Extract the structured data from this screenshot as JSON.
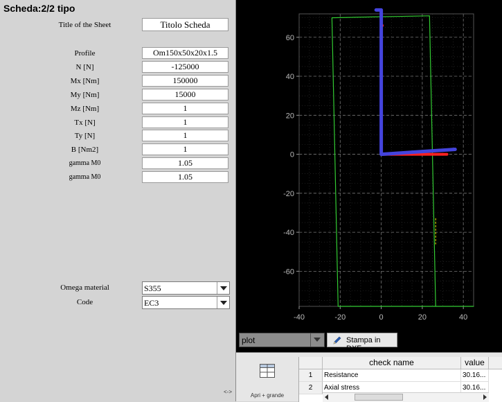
{
  "sheet_title": "Scheda:2/2 tipo",
  "form": {
    "title_of_sheet": {
      "label": "Title of the Sheet",
      "value": "Titolo Scheda"
    },
    "fields": [
      {
        "label": "Profile",
        "value": "Om150x50x20x1.5"
      },
      {
        "label": "N [N]",
        "value": "-125000"
      },
      {
        "label": "Mx [Nm]",
        "value": "150000"
      },
      {
        "label": "My [Nm]",
        "value": "15000"
      },
      {
        "label": "Mz [Nm]",
        "value": "1"
      },
      {
        "label": "Tx [N]",
        "value": "1"
      },
      {
        "label": "Ty [N]",
        "value": "1"
      },
      {
        "label": "B [Nm2]",
        "value": "1"
      },
      {
        "label": "gamma M0",
        "value": "1.05"
      },
      {
        "label": "gamma M0",
        "value": "1.05"
      }
    ],
    "omega_material": {
      "label": "Omega material",
      "value": "S355"
    },
    "code": {
      "label": "Code",
      "value": "EC3"
    },
    "resize_mark": "<->"
  },
  "plot": {
    "x_ticks": [
      "-40",
      "-20",
      "0",
      "20",
      "40"
    ],
    "y_ticks": [
      "60",
      "40",
      "20",
      "0",
      "-20",
      "-40",
      "-60"
    ],
    "colors": {
      "outline": "#33cc33",
      "red_axis": "#ff2222",
      "blue_axis": "#4444dd",
      "marker": "#cccc00",
      "grid": "#777777",
      "background": "#000000"
    },
    "select_value": "plot",
    "dxf_button": "Stampa in DXF"
  },
  "chart_data": {
    "type": "line",
    "title": "",
    "xlabel": "",
    "ylabel": "",
    "xlim": [
      -40,
      45
    ],
    "ylim": [
      -78,
      72
    ],
    "grid": true,
    "series": [
      {
        "kind": "outline",
        "color": "#33cc33",
        "x": [
          -24,
          23.5,
          26.5,
          45,
          45,
          -21,
          -24
        ],
        "y": [
          70,
          71,
          -78,
          -78,
          -78,
          -78,
          70
        ]
      },
      {
        "kind": "red",
        "color": "#ff2222",
        "x": [
          0.5,
          0,
          0,
          32
        ],
        "y": [
          66,
          66,
          0,
          0
        ]
      },
      {
        "kind": "blue",
        "color": "#4444dd",
        "x": [
          -2.5,
          0,
          0,
          36
        ],
        "y": [
          74,
          74,
          0,
          2.5
        ]
      },
      {
        "kind": "marker",
        "color": "#cccc00",
        "x": [
          26.5,
          26.5
        ],
        "y": [
          -33,
          -46
        ]
      }
    ]
  },
  "results_panel": {
    "open_large_label": "Apri + grande",
    "columns": [
      "check name",
      "value"
    ],
    "rows": [
      {
        "n": "1",
        "name": "Resistance",
        "value": "30.16..."
      },
      {
        "n": "2",
        "name": "Axial stress",
        "value": "30.16..."
      }
    ]
  }
}
